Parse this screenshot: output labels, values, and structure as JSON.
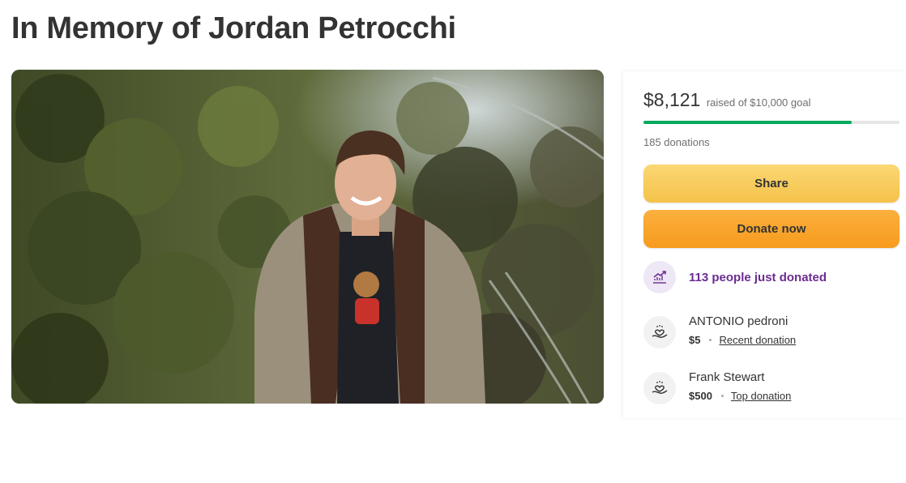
{
  "page": {
    "title": "In Memory of Jordan Petrocchi"
  },
  "fundraiser": {
    "raised_amount": "$8,121",
    "raised_goal_text": "raised of $10,000 goal",
    "progress_fraction": 0.8121,
    "donations_text": "185 donations",
    "share_label": "Share",
    "donate_label": "Donate now",
    "trend_text": "113 people just donated"
  },
  "donors": [
    {
      "name": "ANTONIO pedroni",
      "amount": "$5",
      "tag": "Recent donation"
    },
    {
      "name": "Frank Stewart",
      "amount": "$500",
      "tag": "Top donation"
    }
  ],
  "colors": {
    "progress": "#02a95c",
    "share_button": "#f4c24a",
    "donate_button": "#f79b1d",
    "trend_text": "#6b2c91"
  },
  "icons": {
    "trend": "trending-up-icon",
    "donor": "heart-hand-icon"
  }
}
